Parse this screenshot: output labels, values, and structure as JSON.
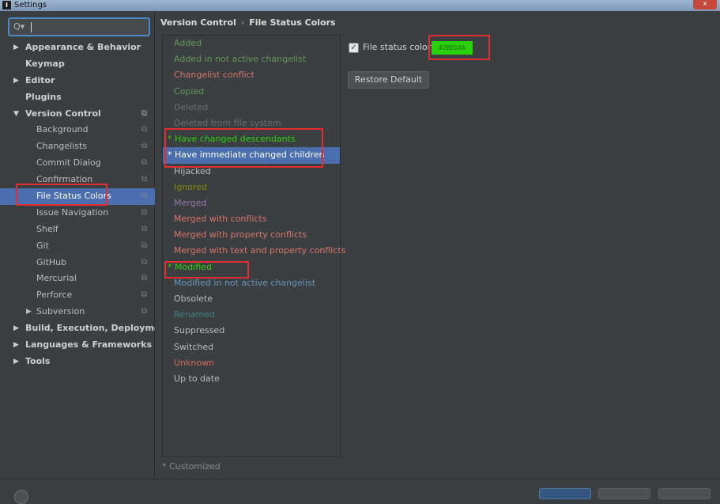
{
  "window": {
    "title": "Settings",
    "app_icon": "intellij-icon",
    "close_label": "x"
  },
  "search": {
    "icon": "search-icon",
    "glyph": "Q▾"
  },
  "tree": [
    {
      "label": "Appearance & Behavior",
      "level": 0,
      "bold": true,
      "arrow": "▶"
    },
    {
      "label": "Keymap",
      "level": 0,
      "bold": true
    },
    {
      "label": "Editor",
      "level": 0,
      "bold": true,
      "arrow": "▶"
    },
    {
      "label": "Plugins",
      "level": 0,
      "bold": true
    },
    {
      "label": "Version Control",
      "level": 0,
      "bold": true,
      "arrow": "▼",
      "cfg": true
    },
    {
      "label": "Background",
      "level": 1,
      "cfg": true
    },
    {
      "label": "Changelists",
      "level": 1,
      "cfg": true
    },
    {
      "label": "Commit Dialog",
      "level": 1,
      "cfg": true
    },
    {
      "label": "Confirmation",
      "level": 1,
      "cfg": true
    },
    {
      "label": "File Status Colors",
      "level": 1,
      "cfg": true,
      "selected": true
    },
    {
      "label": "Issue Navigation",
      "level": 1,
      "cfg": true
    },
    {
      "label": "Shelf",
      "level": 1,
      "cfg": true
    },
    {
      "label": "Git",
      "level": 1,
      "cfg": true
    },
    {
      "label": "GitHub",
      "level": 1,
      "cfg": true
    },
    {
      "label": "Mercurial",
      "level": 1,
      "cfg": true
    },
    {
      "label": "Perforce",
      "level": 1,
      "cfg": true
    },
    {
      "label": "Subversion",
      "level": 1,
      "cfg": true,
      "arrow": "▶"
    },
    {
      "label": "Build, Execution, Deployment",
      "level": 0,
      "bold": true,
      "arrow": "▶"
    },
    {
      "label": "Languages & Frameworks",
      "level": 0,
      "bold": true,
      "arrow": "▶"
    },
    {
      "label": "Tools",
      "level": 0,
      "bold": true,
      "arrow": "▶"
    }
  ],
  "breadcrumb": {
    "section": "Version Control",
    "separator": "›",
    "page": "File Status Colors"
  },
  "statuses": [
    {
      "label": "Added",
      "color": "#629755"
    },
    {
      "label": "Added in not active changelist",
      "color": "#629755"
    },
    {
      "label": "Changelist conflict",
      "color": "#d5756c"
    },
    {
      "label": "Copied",
      "color": "#629755"
    },
    {
      "label": "Deleted",
      "color": "#6c6c6c"
    },
    {
      "label": "Deleted from file system",
      "color": "#6c6c6c"
    },
    {
      "label": "* Have changed descendants",
      "color": "#2bd10a",
      "customized": true
    },
    {
      "label": "* Have immediate changed children",
      "color": "#ffffff",
      "customized": true,
      "selected": true
    },
    {
      "label": "Hijacked",
      "color": "#bbbbbb"
    },
    {
      "label": "Ignored",
      "color": "#848504"
    },
    {
      "label": "Merged",
      "color": "#9876aa"
    },
    {
      "label": "Merged with conflicts",
      "color": "#d5756c"
    },
    {
      "label": "Merged with property conflicts",
      "color": "#d5756c"
    },
    {
      "label": "Merged with text and property conflicts",
      "color": "#d5756c"
    },
    {
      "label": "* Modified",
      "color": "#2bd10a",
      "customized": true
    },
    {
      "label": "Modified in not active changelist",
      "color": "#6897bb"
    },
    {
      "label": "Obsolete",
      "color": "#bbbbbb"
    },
    {
      "label": "Renamed",
      "color": "#3a8484"
    },
    {
      "label": "Suppressed",
      "color": "#bbbbbb"
    },
    {
      "label": "Switched",
      "color": "#bbbbbb"
    },
    {
      "label": "Unknown",
      "color": "#d1675a"
    },
    {
      "label": "Up to date",
      "color": "#bbbbbb"
    }
  ],
  "footnote": "* Customized",
  "option": {
    "checkbox_checked": true,
    "check_glyph": "✓",
    "label": "File status color:",
    "swatch_value": "#2BD10A",
    "swatch_color": "#2bd10a"
  },
  "restore_label": "Restore Default",
  "highlight_color": "#e22d33"
}
